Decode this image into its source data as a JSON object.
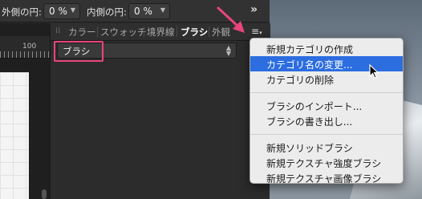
{
  "toolbar": {
    "outer_radius_label": "外側の円:",
    "outer_radius_value": "0 %",
    "inner_radius_label": "内側の円:",
    "inner_radius_value": "0 %",
    "more_icon": "double-chevron-right"
  },
  "ruler": {
    "mark": "100"
  },
  "panel": {
    "tabs": [
      {
        "label": "カラー",
        "active": false
      },
      {
        "label": "スウォッチ",
        "active": false
      },
      {
        "label": "境界線",
        "active": false
      },
      {
        "label": "ブラシ",
        "active": true
      },
      {
        "label": "外観",
        "active": false
      }
    ],
    "menu_icon": "hamburger-menu",
    "category_value": "ブラシ"
  },
  "popup_menu": {
    "groups": [
      [
        "新規カテゴリの作成",
        "カテゴリ名の変更...",
        "カテゴリの削除"
      ],
      [
        "ブラシのインポート...",
        "ブラシの書き出し..."
      ],
      [
        "新規ソリッドブラシ",
        "新規テクスチャ強度ブラシ",
        "新規テクスチャ画像ブラシ"
      ]
    ],
    "selected": "カテゴリ名の変更..."
  },
  "colors": {
    "highlight": "#e8457c",
    "selection": "#2c6de0"
  }
}
